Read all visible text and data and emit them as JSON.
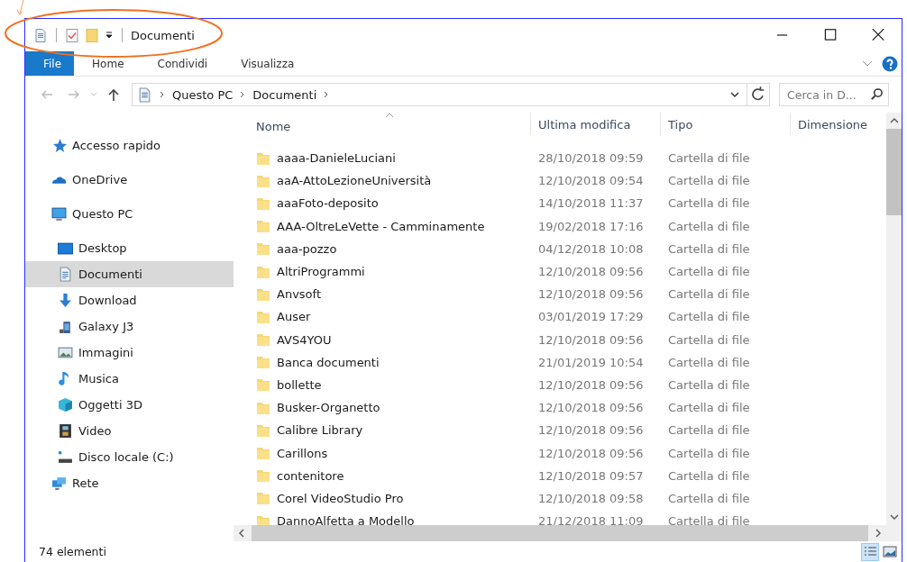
{
  "window": {
    "title": "Documenti"
  },
  "ribbon_tabs": [
    {
      "label": "File",
      "selected": true
    },
    {
      "label": "Home",
      "selected": false
    },
    {
      "label": "Condividi",
      "selected": false
    },
    {
      "label": "Visualizza",
      "selected": false
    }
  ],
  "address_bar": {
    "path": [
      "Questo PC",
      "Documenti"
    ]
  },
  "search": {
    "placeholder": "Cerca in D..."
  },
  "sidebar": {
    "items": [
      {
        "label": "Accesso rapido",
        "selected": false
      },
      {
        "label": "OneDrive",
        "selected": false
      },
      {
        "label": "Questo PC",
        "selected": false,
        "children": [
          {
            "label": "Desktop",
            "selected": false
          },
          {
            "label": "Documenti",
            "selected": true
          },
          {
            "label": "Download",
            "selected": false
          },
          {
            "label": "Galaxy J3",
            "selected": false
          },
          {
            "label": "Immagini",
            "selected": false
          },
          {
            "label": "Musica",
            "selected": false
          },
          {
            "label": "Oggetti 3D",
            "selected": false
          },
          {
            "label": "Video",
            "selected": false
          },
          {
            "label": "Disco locale (C:)",
            "selected": false
          }
        ]
      },
      {
        "label": "Rete",
        "selected": false
      }
    ]
  },
  "table": {
    "columns": [
      "Nome",
      "Ultima modifica",
      "Tipo",
      "Dimensione"
    ],
    "rows": [
      {
        "name": "aaaa-DanieleLuciani",
        "modified": "28/10/2018 09:59",
        "type": "Cartella di file"
      },
      {
        "name": "aaA-AttoLezioneUniversità",
        "modified": "12/10/2018 09:54",
        "type": "Cartella di file"
      },
      {
        "name": "aaaFoto-deposito",
        "modified": "14/10/2018 11:37",
        "type": "Cartella di file"
      },
      {
        "name": "AAA-OltreLeVette - Camminamente",
        "modified": "19/02/2018 17:16",
        "type": "Cartella di file"
      },
      {
        "name": "aaa-pozzo",
        "modified": "04/12/2018 10:08",
        "type": "Cartella di file"
      },
      {
        "name": "AltriProgrammi",
        "modified": "12/10/2018 09:56",
        "type": "Cartella di file"
      },
      {
        "name": "Anvsoft",
        "modified": "12/10/2018 09:56",
        "type": "Cartella di file"
      },
      {
        "name": "Auser",
        "modified": "03/01/2019 17:29",
        "type": "Cartella di file"
      },
      {
        "name": "AVS4YOU",
        "modified": "12/10/2018 09:56",
        "type": "Cartella di file"
      },
      {
        "name": "Banca documenti",
        "modified": "21/01/2019 10:54",
        "type": "Cartella di file"
      },
      {
        "name": "bollette",
        "modified": "12/10/2018 09:56",
        "type": "Cartella di file"
      },
      {
        "name": "Busker-Organetto",
        "modified": "12/10/2018 09:56",
        "type": "Cartella di file"
      },
      {
        "name": "Calibre Library",
        "modified": "12/10/2018 09:56",
        "type": "Cartella di file"
      },
      {
        "name": "Carillons",
        "modified": "12/10/2018 09:56",
        "type": "Cartella di file"
      },
      {
        "name": "contenitore",
        "modified": "12/10/2018 09:57",
        "type": "Cartella di file"
      },
      {
        "name": "Corel VideoStudio Pro",
        "modified": "12/10/2018 09:58",
        "type": "Cartella di file"
      },
      {
        "name": "DannoAlfetta a Modello",
        "modified": "21/12/2018 11:09",
        "type": "Cartella di file"
      }
    ]
  },
  "status_bar": {
    "item_count": "74 elementi"
  }
}
